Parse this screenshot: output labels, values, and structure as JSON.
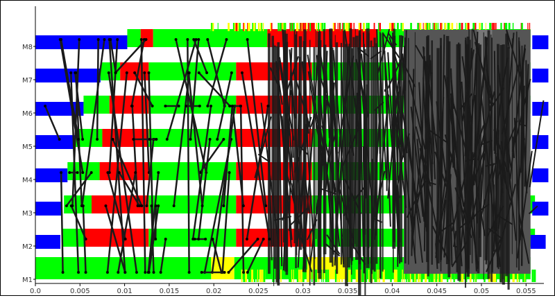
{
  "chart_data": {
    "type": "timeline",
    "title": "",
    "xlabel": "",
    "ylabel": "",
    "xlim": [
      0.0,
      0.057
    ],
    "x_ticks": [
      "0.0",
      "0.005",
      "0.01",
      "0.015",
      "0.02",
      "0.025",
      "0.03",
      "0.035",
      "0.04",
      "0.045",
      "0.05",
      "0.055"
    ],
    "x_tick_values": [
      0.0,
      0.005,
      0.01,
      0.015,
      0.02,
      0.025,
      0.03,
      0.035,
      0.04,
      0.045,
      0.05,
      0.055
    ],
    "y_ticks": [
      "M1",
      "M2",
      "M3",
      "M4",
      "M5",
      "M6",
      "M7",
      "M8"
    ],
    "colors": {
      "blue": "#0000ff",
      "green": "#00ff00",
      "red": "#ff0000",
      "yellow": "#ffff00",
      "dark_gray": "#1a1a1a",
      "gray": "#555555",
      "white": "#ffffff"
    },
    "rows": [
      {
        "name": "M1",
        "blue_end": 0.0,
        "segments": [
          {
            "start": 0.0,
            "end": 0.0197,
            "color": "green"
          },
          {
            "start": 0.0197,
            "end": 0.0223,
            "color": "yellow"
          },
          {
            "start": 0.0223,
            "end": 0.0305,
            "color": "green"
          },
          {
            "start": 0.0305,
            "end": 0.035,
            "color": "yellow"
          },
          {
            "start": 0.035,
            "end": 0.0555,
            "color": "green"
          }
        ]
      },
      {
        "name": "M2",
        "blue_end": 0.0028,
        "segments": [
          {
            "start": 0.003,
            "end": 0.0055,
            "color": "green"
          },
          {
            "start": 0.0055,
            "end": 0.0127,
            "color": "red"
          },
          {
            "start": 0.0127,
            "end": 0.0225,
            "color": "green"
          },
          {
            "start": 0.0225,
            "end": 0.031,
            "color": "red"
          },
          {
            "start": 0.031,
            "end": 0.056,
            "color": "green"
          }
        ],
        "tail_blue": [
          0.0555,
          0.0572
        ]
      },
      {
        "name": "M3",
        "blue_end": 0.003,
        "segments": [
          {
            "start": 0.0032,
            "end": 0.0063,
            "color": "green"
          },
          {
            "start": 0.0063,
            "end": 0.0127,
            "color": "red"
          },
          {
            "start": 0.0127,
            "end": 0.0225,
            "color": "green"
          },
          {
            "start": 0.0225,
            "end": 0.031,
            "color": "red"
          },
          {
            "start": 0.031,
            "end": 0.056,
            "color": "green"
          }
        ],
        "tail_blue": [
          0.0557,
          0.0575
        ]
      },
      {
        "name": "M4",
        "blue_end": 0.0036,
        "segments": [
          {
            "start": 0.0036,
            "end": 0.0072,
            "color": "green"
          },
          {
            "start": 0.0072,
            "end": 0.0127,
            "color": "red"
          },
          {
            "start": 0.0127,
            "end": 0.0225,
            "color": "green"
          },
          {
            "start": 0.0225,
            "end": 0.031,
            "color": "red"
          },
          {
            "start": 0.031,
            "end": 0.0555,
            "color": "green"
          }
        ],
        "tail_blue": [
          0.0557,
          0.0575
        ]
      },
      {
        "name": "M5",
        "blue_end": 0.0045,
        "segments": [
          {
            "start": 0.0045,
            "end": 0.0075,
            "color": "green"
          },
          {
            "start": 0.0075,
            "end": 0.0127,
            "color": "red"
          },
          {
            "start": 0.0127,
            "end": 0.0225,
            "color": "green"
          },
          {
            "start": 0.0225,
            "end": 0.031,
            "color": "red"
          },
          {
            "start": 0.031,
            "end": 0.0555,
            "color": "green"
          }
        ],
        "tail_blue": [
          0.0557,
          0.0575
        ]
      },
      {
        "name": "M6",
        "blue_end": 0.0054,
        "segments": [
          {
            "start": 0.0054,
            "end": 0.0083,
            "color": "green"
          },
          {
            "start": 0.0083,
            "end": 0.0127,
            "color": "red"
          },
          {
            "start": 0.0127,
            "end": 0.0225,
            "color": "green"
          },
          {
            "start": 0.0225,
            "end": 0.031,
            "color": "red"
          },
          {
            "start": 0.031,
            "end": 0.0555,
            "color": "green"
          }
        ],
        "tail_blue": [
          0.0557,
          0.0575
        ]
      },
      {
        "name": "M7",
        "blue_end": 0.0073,
        "segments": [
          {
            "start": 0.0073,
            "end": 0.0095,
            "color": "green"
          },
          {
            "start": 0.0095,
            "end": 0.0127,
            "color": "red"
          },
          {
            "start": 0.0127,
            "end": 0.0225,
            "color": "green"
          },
          {
            "start": 0.0225,
            "end": 0.031,
            "color": "red"
          },
          {
            "start": 0.031,
            "end": 0.0555,
            "color": "green"
          }
        ],
        "tail_blue": [
          0.0557,
          0.0575
        ]
      },
      {
        "name": "M8",
        "blue_end": 0.0103,
        "segments": [
          {
            "start": 0.0103,
            "end": 0.0118,
            "color": "green"
          },
          {
            "start": 0.0118,
            "end": 0.0132,
            "color": "red"
          },
          {
            "start": 0.0132,
            "end": 0.026,
            "color": "green"
          },
          {
            "start": 0.026,
            "end": 0.0383,
            "color": "red"
          },
          {
            "start": 0.0383,
            "end": 0.0555,
            "color": "green"
          }
        ],
        "tail_blue": [
          0.0557,
          0.0575
        ]
      }
    ],
    "gray_region": [
      0.0413,
      0.0555
    ],
    "gray_region_light": [
      0.0495,
      0.0512
    ]
  }
}
